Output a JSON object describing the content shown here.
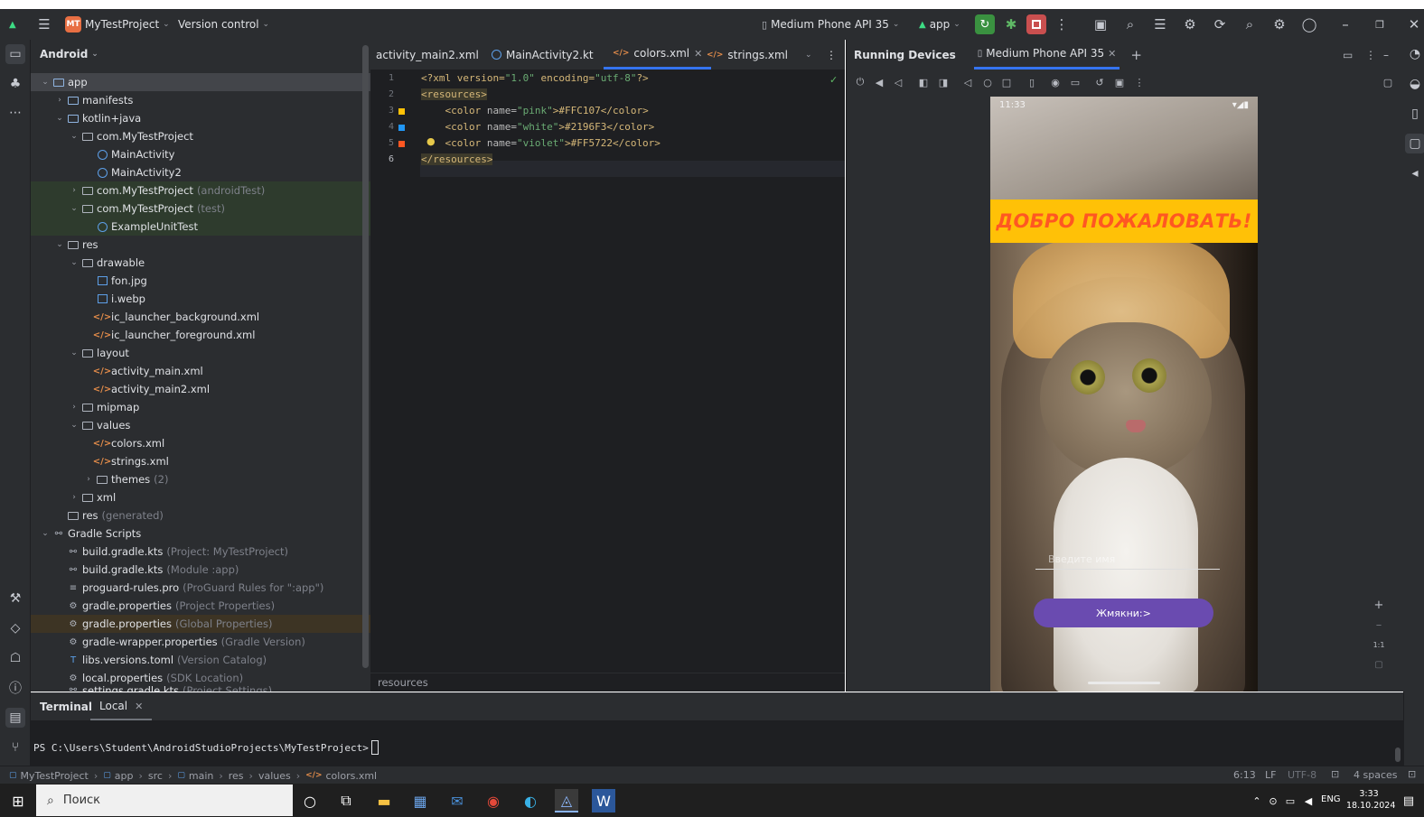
{
  "titlebar": {
    "project_badge": "MT",
    "project_name": "MyTestProject",
    "vcs": "Version control",
    "device": "Medium Phone API 35",
    "run_config": "app"
  },
  "project_panel": {
    "view": "Android",
    "rows": [
      {
        "label": "app",
        "hint": ""
      },
      {
        "label": "manifests",
        "hint": ""
      },
      {
        "label": "kotlin+java",
        "hint": ""
      },
      {
        "label": "com.MyTestProject",
        "hint": ""
      },
      {
        "label": "MainActivity",
        "hint": ""
      },
      {
        "label": "MainActivity2",
        "hint": ""
      },
      {
        "label": "com.MyTestProject",
        "hint": "(androidTest)"
      },
      {
        "label": "com.MyTestProject",
        "hint": "(test)"
      },
      {
        "label": "ExampleUnitTest",
        "hint": ""
      },
      {
        "label": "res",
        "hint": ""
      },
      {
        "label": "drawable",
        "hint": ""
      },
      {
        "label": "fon.jpg",
        "hint": ""
      },
      {
        "label": "i.webp",
        "hint": ""
      },
      {
        "label": "ic_launcher_background.xml",
        "hint": ""
      },
      {
        "label": "ic_launcher_foreground.xml",
        "hint": ""
      },
      {
        "label": "layout",
        "hint": ""
      },
      {
        "label": "activity_main.xml",
        "hint": ""
      },
      {
        "label": "activity_main2.xml",
        "hint": ""
      },
      {
        "label": "mipmap",
        "hint": ""
      },
      {
        "label": "values",
        "hint": ""
      },
      {
        "label": "colors.xml",
        "hint": ""
      },
      {
        "label": "strings.xml",
        "hint": ""
      },
      {
        "label": "themes",
        "hint": "(2)"
      },
      {
        "label": "xml",
        "hint": ""
      },
      {
        "label": "res",
        "hint": "(generated)"
      },
      {
        "label": "Gradle Scripts",
        "hint": ""
      },
      {
        "label": "build.gradle.kts",
        "hint": "(Project: MyTestProject)"
      },
      {
        "label": "build.gradle.kts",
        "hint": "(Module :app)"
      },
      {
        "label": "proguard-rules.pro",
        "hint": "(ProGuard Rules for \":app\")"
      },
      {
        "label": "gradle.properties",
        "hint": "(Project Properties)"
      },
      {
        "label": "gradle.properties",
        "hint": "(Global Properties)"
      },
      {
        "label": "gradle-wrapper.properties",
        "hint": "(Gradle Version)"
      },
      {
        "label": "libs.versions.toml",
        "hint": "(Version Catalog)"
      },
      {
        "label": "local.properties",
        "hint": "(SDK Location)"
      },
      {
        "label": "settings.gradle.kts",
        "hint": "(Project Settings)"
      }
    ]
  },
  "editor": {
    "tabs": [
      "activity_main2.xml",
      "MainActivity2.kt",
      "colors.xml",
      "strings.xml"
    ],
    "active_tab": "colors.xml",
    "line_numbers": [
      "1",
      "2",
      "3",
      "4",
      "5",
      "6"
    ],
    "lines": {
      "l1": {
        "a": "<?xml version=",
        "b": "\"1.0\"",
        "c": " encoding=",
        "d": "\"utf-8\"",
        "e": "?>"
      },
      "l2": {
        "a": "<resources>"
      },
      "l3": {
        "a": "<color ",
        "b": "name=",
        "c": "\"pink\"",
        "d": ">#FFC107</color>"
      },
      "l4": {
        "a": "<color ",
        "b": "name=",
        "c": "\"white\"",
        "d": ">#2196F3</color>"
      },
      "l5": {
        "a": "<color ",
        "b": "name=",
        "c": "\"violet\"",
        "d": ">#FF5722</color>"
      },
      "l6": {
        "a": "</resources>"
      }
    },
    "swatches": [
      "#FFC107",
      "#2196F3",
      "#FF5722"
    ],
    "breadcrumb": "resources"
  },
  "devices": {
    "title": "Running Devices",
    "device_tab": "Medium Phone API 35",
    "phone": {
      "time": "11:33",
      "banner": "ДОБРО ПОЖАЛОВАТЬ!",
      "input_placeholder": "Введите имя",
      "button": "Жмякни:>"
    },
    "zoom_label": "1:1"
  },
  "terminal": {
    "title": "Terminal",
    "tab": "Local",
    "prompt": "PS C:\\Users\\Student\\AndroidStudioProjects\\MyTestProject>"
  },
  "statusbar": {
    "crumbs": [
      "MyTestProject",
      "app",
      "src",
      "main",
      "res",
      "values",
      "colors.xml"
    ],
    "position": "6:13",
    "line_sep": "LF",
    "encoding": "UTF-8",
    "indent": "4 spaces"
  },
  "taskbar": {
    "search_placeholder": "Поиск",
    "lang": "ENG",
    "time": "3:33",
    "date": "18.10.2024"
  }
}
